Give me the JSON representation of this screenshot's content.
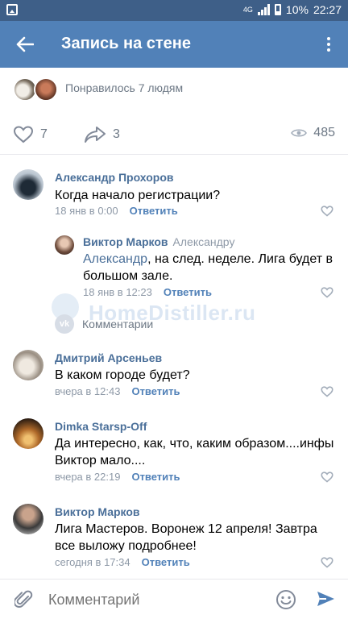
{
  "status_bar": {
    "network": "4G",
    "battery": "10%",
    "time": "22:27"
  },
  "app_bar": {
    "title": "Запись на стене"
  },
  "likes": {
    "text": "Понравилось 7 людям"
  },
  "actions": {
    "like_count": "7",
    "share_count": "3",
    "view_count": "485"
  },
  "comments": [
    {
      "name": "Александр Прохоров",
      "text": "Когда начало регистрации?",
      "time": "18 янв в 0:00",
      "reply_label": "Ответить"
    },
    {
      "name": "Виктор Марков",
      "reply_to": "Александру",
      "mention": "Александр",
      "text_after_mention": ", на след. неделе. Лига будет в\nбольшом зале.",
      "time": "18 янв в 12:23",
      "reply_label": "Ответить"
    },
    {
      "name": "Дмитрий Арсеньев",
      "text": "В каком городе будет?",
      "time": "вчера в 12:43",
      "reply_label": "Ответить"
    },
    {
      "name": "Dimka Starsp-Off",
      "text": "Да интересно, как, что, каким образом....инфы\nВиктор мало....",
      "time": "вчера в 22:19",
      "reply_label": "Ответить"
    },
    {
      "name": "Виктор Марков",
      "text": "Лига Мастеров. Воронеж 12 апреля! Завтра\nвсе выложу подробнее!",
      "time": "сегодня в 17:34",
      "reply_label": "Ответить"
    }
  ],
  "more_comments": {
    "label": "Комментарии"
  },
  "watermark": "HomeDistiller.ru",
  "composer": {
    "placeholder": "Комментарий"
  },
  "colors": {
    "accent": "#5181b8",
    "name": "#4a6f99",
    "muted": "#8e99a7"
  }
}
